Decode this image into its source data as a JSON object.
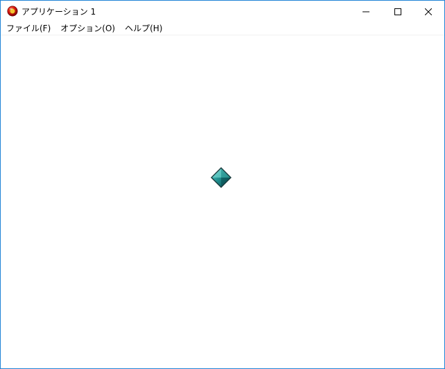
{
  "window": {
    "title": "アプリケーション 1",
    "app_icon": "red-orb-app-icon"
  },
  "caption_buttons": {
    "minimize_icon": "minimize-icon",
    "maximize_icon": "maximize-icon",
    "close_icon": "close-icon"
  },
  "menu": {
    "items": [
      {
        "label": "ファイル(F)"
      },
      {
        "label": "オプション(O)"
      },
      {
        "label": "ヘルプ(H)"
      }
    ]
  },
  "client": {
    "sprite_icon": "teal-diamond-icon",
    "sprite_color": "#1e8c8c",
    "background": "#ffffff"
  },
  "colors": {
    "window_border": "#1e83d6",
    "icon_red": "#d8140c"
  }
}
